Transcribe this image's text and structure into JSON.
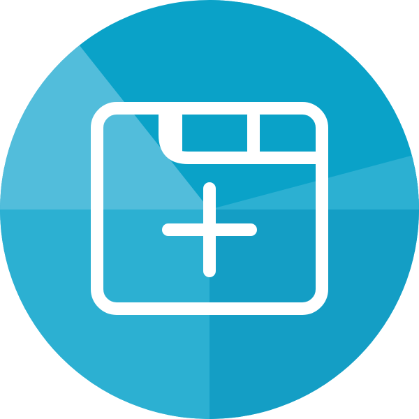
{
  "icon": {
    "name": "new-tab-icon",
    "glyph": "plus-icon",
    "colors": {
      "background": "#ffffff",
      "circle_dark": "#0aa2c8",
      "circle_light": "#52bddb",
      "circle_mid": "#2cb0d2",
      "circle_deep": "#149ec5",
      "stroke": "#ffffff"
    }
  }
}
